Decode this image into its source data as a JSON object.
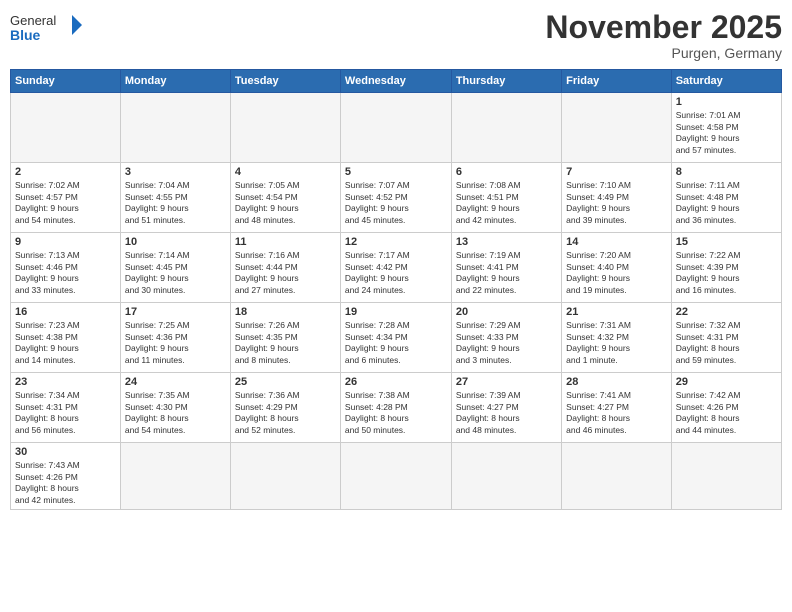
{
  "logo": {
    "text_general": "General",
    "text_blue": "Blue"
  },
  "header": {
    "month": "November 2025",
    "location": "Purgen, Germany"
  },
  "weekdays": [
    "Sunday",
    "Monday",
    "Tuesday",
    "Wednesday",
    "Thursday",
    "Friday",
    "Saturday"
  ],
  "weeks": [
    [
      {
        "day": "",
        "info": ""
      },
      {
        "day": "",
        "info": ""
      },
      {
        "day": "",
        "info": ""
      },
      {
        "day": "",
        "info": ""
      },
      {
        "day": "",
        "info": ""
      },
      {
        "day": "",
        "info": ""
      },
      {
        "day": "1",
        "info": "Sunrise: 7:01 AM\nSunset: 4:58 PM\nDaylight: 9 hours\nand 57 minutes."
      }
    ],
    [
      {
        "day": "2",
        "info": "Sunrise: 7:02 AM\nSunset: 4:57 PM\nDaylight: 9 hours\nand 54 minutes."
      },
      {
        "day": "3",
        "info": "Sunrise: 7:04 AM\nSunset: 4:55 PM\nDaylight: 9 hours\nand 51 minutes."
      },
      {
        "day": "4",
        "info": "Sunrise: 7:05 AM\nSunset: 4:54 PM\nDaylight: 9 hours\nand 48 minutes."
      },
      {
        "day": "5",
        "info": "Sunrise: 7:07 AM\nSunset: 4:52 PM\nDaylight: 9 hours\nand 45 minutes."
      },
      {
        "day": "6",
        "info": "Sunrise: 7:08 AM\nSunset: 4:51 PM\nDaylight: 9 hours\nand 42 minutes."
      },
      {
        "day": "7",
        "info": "Sunrise: 7:10 AM\nSunset: 4:49 PM\nDaylight: 9 hours\nand 39 minutes."
      },
      {
        "day": "8",
        "info": "Sunrise: 7:11 AM\nSunset: 4:48 PM\nDaylight: 9 hours\nand 36 minutes."
      }
    ],
    [
      {
        "day": "9",
        "info": "Sunrise: 7:13 AM\nSunset: 4:46 PM\nDaylight: 9 hours\nand 33 minutes."
      },
      {
        "day": "10",
        "info": "Sunrise: 7:14 AM\nSunset: 4:45 PM\nDaylight: 9 hours\nand 30 minutes."
      },
      {
        "day": "11",
        "info": "Sunrise: 7:16 AM\nSunset: 4:44 PM\nDaylight: 9 hours\nand 27 minutes."
      },
      {
        "day": "12",
        "info": "Sunrise: 7:17 AM\nSunset: 4:42 PM\nDaylight: 9 hours\nand 24 minutes."
      },
      {
        "day": "13",
        "info": "Sunrise: 7:19 AM\nSunset: 4:41 PM\nDaylight: 9 hours\nand 22 minutes."
      },
      {
        "day": "14",
        "info": "Sunrise: 7:20 AM\nSunset: 4:40 PM\nDaylight: 9 hours\nand 19 minutes."
      },
      {
        "day": "15",
        "info": "Sunrise: 7:22 AM\nSunset: 4:39 PM\nDaylight: 9 hours\nand 16 minutes."
      }
    ],
    [
      {
        "day": "16",
        "info": "Sunrise: 7:23 AM\nSunset: 4:38 PM\nDaylight: 9 hours\nand 14 minutes."
      },
      {
        "day": "17",
        "info": "Sunrise: 7:25 AM\nSunset: 4:36 PM\nDaylight: 9 hours\nand 11 minutes."
      },
      {
        "day": "18",
        "info": "Sunrise: 7:26 AM\nSunset: 4:35 PM\nDaylight: 9 hours\nand 8 minutes."
      },
      {
        "day": "19",
        "info": "Sunrise: 7:28 AM\nSunset: 4:34 PM\nDaylight: 9 hours\nand 6 minutes."
      },
      {
        "day": "20",
        "info": "Sunrise: 7:29 AM\nSunset: 4:33 PM\nDaylight: 9 hours\nand 3 minutes."
      },
      {
        "day": "21",
        "info": "Sunrise: 7:31 AM\nSunset: 4:32 PM\nDaylight: 9 hours\nand 1 minute."
      },
      {
        "day": "22",
        "info": "Sunrise: 7:32 AM\nSunset: 4:31 PM\nDaylight: 8 hours\nand 59 minutes."
      }
    ],
    [
      {
        "day": "23",
        "info": "Sunrise: 7:34 AM\nSunset: 4:31 PM\nDaylight: 8 hours\nand 56 minutes."
      },
      {
        "day": "24",
        "info": "Sunrise: 7:35 AM\nSunset: 4:30 PM\nDaylight: 8 hours\nand 54 minutes."
      },
      {
        "day": "25",
        "info": "Sunrise: 7:36 AM\nSunset: 4:29 PM\nDaylight: 8 hours\nand 52 minutes."
      },
      {
        "day": "26",
        "info": "Sunrise: 7:38 AM\nSunset: 4:28 PM\nDaylight: 8 hours\nand 50 minutes."
      },
      {
        "day": "27",
        "info": "Sunrise: 7:39 AM\nSunset: 4:27 PM\nDaylight: 8 hours\nand 48 minutes."
      },
      {
        "day": "28",
        "info": "Sunrise: 7:41 AM\nSunset: 4:27 PM\nDaylight: 8 hours\nand 46 minutes."
      },
      {
        "day": "29",
        "info": "Sunrise: 7:42 AM\nSunset: 4:26 PM\nDaylight: 8 hours\nand 44 minutes."
      }
    ],
    [
      {
        "day": "30",
        "info": "Sunrise: 7:43 AM\nSunset: 4:26 PM\nDaylight: 8 hours\nand 42 minutes."
      },
      {
        "day": "",
        "info": ""
      },
      {
        "day": "",
        "info": ""
      },
      {
        "day": "",
        "info": ""
      },
      {
        "day": "",
        "info": ""
      },
      {
        "day": "",
        "info": ""
      },
      {
        "day": "",
        "info": ""
      }
    ]
  ]
}
